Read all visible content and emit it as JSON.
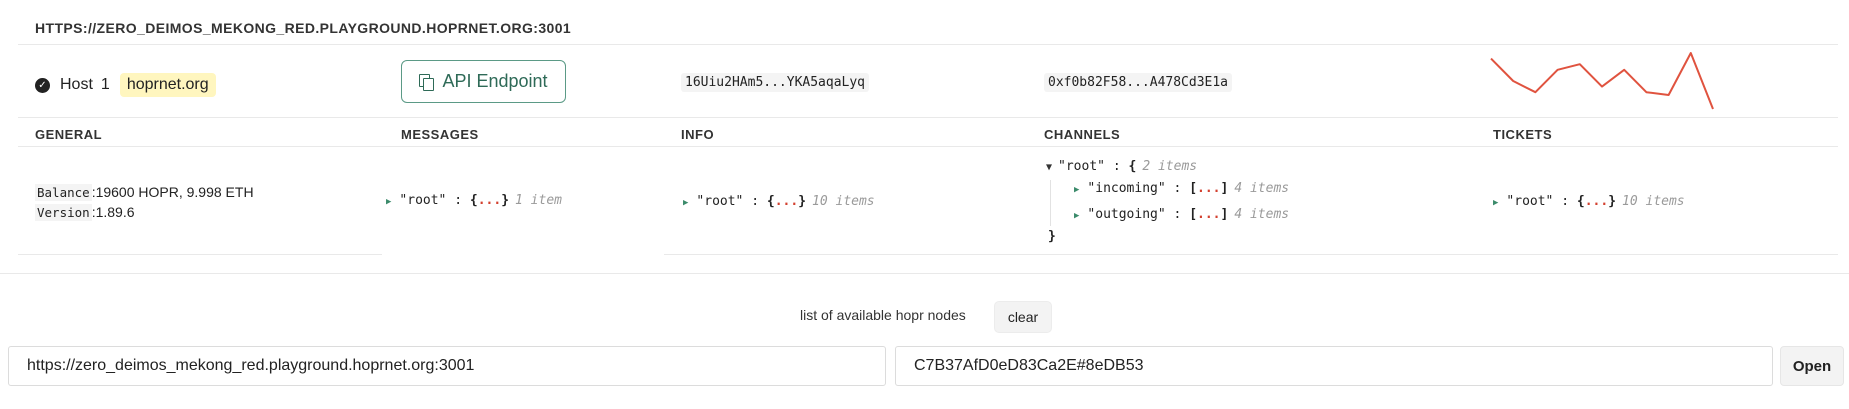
{
  "node": {
    "url_title": "HTTPS://ZERO_DEIMOS_MEKONG_RED.PLAYGROUND.HOPRNET.ORG:3001",
    "host_label": "Host",
    "host_number": "1",
    "host_domain": "hoprnet.org",
    "api_button_label": "API Endpoint",
    "peer_id": "16Uiu2HAm5...YKA5aqaLyq",
    "eth_address": "0xf0b82F58...A478Cd3E1a",
    "sparkline": {
      "color": "#e0533f",
      "values": [
        5,
        9,
        11,
        7,
        6,
        10,
        7,
        11,
        11.5,
        4,
        14
      ]
    }
  },
  "columns": {
    "general": "GENERAL",
    "messages": "MESSAGES",
    "info": "INFO",
    "channels": "CHANNELS",
    "tickets": "TICKETS"
  },
  "general": {
    "balance_key": "Balance",
    "balance_value": "19600 HOPR, 9.998 ETH",
    "version_key": "Version",
    "version_value": "1.89.6"
  },
  "messages": {
    "key": "\"root\"",
    "sep": ":",
    "open": "{",
    "ellipsis": "...",
    "close": "}",
    "count": "1 item"
  },
  "info": {
    "key": "\"root\"",
    "sep": ":",
    "open": "{",
    "ellipsis": "...",
    "close": "}",
    "count": "10 items"
  },
  "channels": {
    "root_key": "\"root\"",
    "sep": ":",
    "open": "{",
    "close": "}",
    "root_count": "2 items",
    "incoming_key": "\"incoming\"",
    "incoming_count": "4 items",
    "outgoing_key": "\"outgoing\"",
    "outgoing_count": "4 items",
    "arr_open": "[",
    "ellipsis": "...",
    "arr_close": "]"
  },
  "tickets": {
    "key": "\"root\"",
    "sep": ":",
    "open": "{",
    "ellipsis": "...",
    "close": "}",
    "count": "10 items"
  },
  "footer": {
    "list_label": "list of available hopr nodes",
    "clear_label": "clear",
    "endpoint_value": "https://zero_deimos_mekong_red.playground.hoprnet.org:3001",
    "token_value": "C7B37AfD0eD83Ca2E#8eDB53",
    "open_label": "Open"
  }
}
